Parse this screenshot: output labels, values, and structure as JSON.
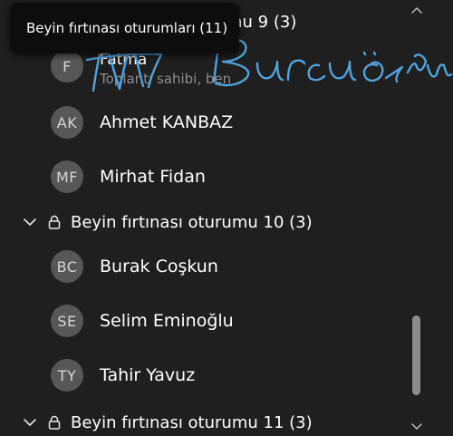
{
  "tooltip": {
    "text": "Beyin fırtınası oturumları (11)"
  },
  "partial_group_title": "mu 9 (3)",
  "group9_members": [
    {
      "initials": "F",
      "name": "Fatma",
      "subtitle": "Toplantı sahibi, ben"
    },
    {
      "initials": "AK",
      "name": "Ahmet KANBAZ"
    },
    {
      "initials": "MF",
      "name": "Mirhat Fidan"
    }
  ],
  "group10": {
    "title": "Beyin fırtınası oturumu 10 (3)",
    "members": [
      {
        "initials": "BC",
        "name": "Burak Coşkun"
      },
      {
        "initials": "SE",
        "name": "Selim Eminoğlu"
      },
      {
        "initials": "TY",
        "name": "Tahir Yavuz"
      }
    ]
  },
  "group11": {
    "title": "Beyin fırtınası oturumu 11 (3)"
  },
  "annotation": {
    "handwriting": "Burcu Özdemir",
    "ink_color": "#4fa3e0"
  },
  "icons": {
    "expand": "chevron-down-icon",
    "lock": "lock-icon",
    "scroll_up": "chevron-up-icon",
    "scroll_down": "chevron-down-icon"
  },
  "colors": {
    "background": "#1f1f1f",
    "avatar": "#575757",
    "tooltip_bg": "#0d0d0d",
    "muted_text": "#8d8d8d",
    "scroll_thumb": "#8a8a8a"
  }
}
